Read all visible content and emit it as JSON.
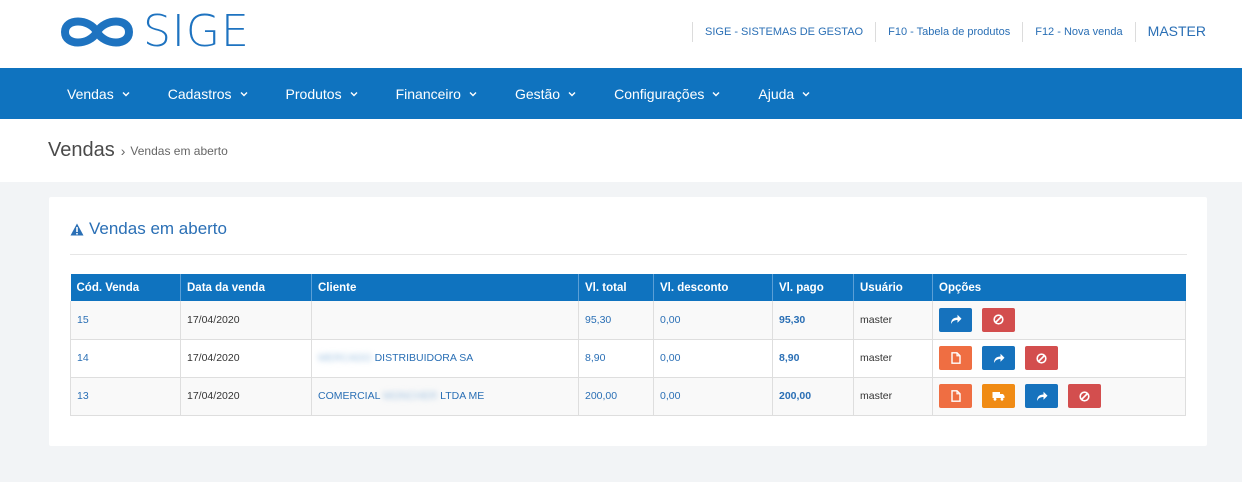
{
  "header": {
    "logo_text": "SIGE",
    "links": [
      "SIGE - SISTEMAS DE GESTAO",
      "F10 - Tabela de produtos",
      "F12 - Nova venda"
    ],
    "user": "MASTER"
  },
  "nav": [
    "Vendas",
    "Cadastros",
    "Produtos",
    "Financeiro",
    "Gestão",
    "Configurações",
    "Ajuda"
  ],
  "breadcrumb": {
    "title": "Vendas",
    "separator": "›",
    "current": "Vendas em aberto"
  },
  "panel": {
    "title": "Vendas em aberto"
  },
  "table": {
    "headers": [
      "Cód. Venda",
      "Data da venda",
      "Cliente",
      "Vl. total",
      "Vl. desconto",
      "Vl. pago",
      "Usuário",
      "Opções"
    ],
    "rows": [
      {
        "codigo": "15",
        "data": "17/04/2020",
        "cliente": "",
        "total": "95,30",
        "desconto": "0,00",
        "pago": "95,30",
        "usuario": "master"
      },
      {
        "codigo": "14",
        "data": "17/04/2020",
        "cliente_hidden": "MERCADO",
        "cliente": "DISTRIBUIDORA SA",
        "total": "8,90",
        "desconto": "0,00",
        "pago": "8,90",
        "usuario": "master"
      },
      {
        "codigo": "13",
        "data": "17/04/2020",
        "cliente_prefix": "COMERCIAL",
        "cliente_hidden": "MONCHER",
        "cliente": "LTDA ME",
        "total": "200,00",
        "desconto": "0,00",
        "pago": "200,00",
        "usuario": "master"
      }
    ]
  },
  "colors": {
    "primary": "#0f73bf",
    "link": "#2a6fb5",
    "danger": "#d34e4e",
    "orange": "#ef6e42",
    "amber": "#f08b14"
  },
  "icons": [
    "share-icon",
    "ban-icon",
    "document-icon",
    "truck-icon",
    "warning-icon",
    "chevron-down-icon"
  ]
}
